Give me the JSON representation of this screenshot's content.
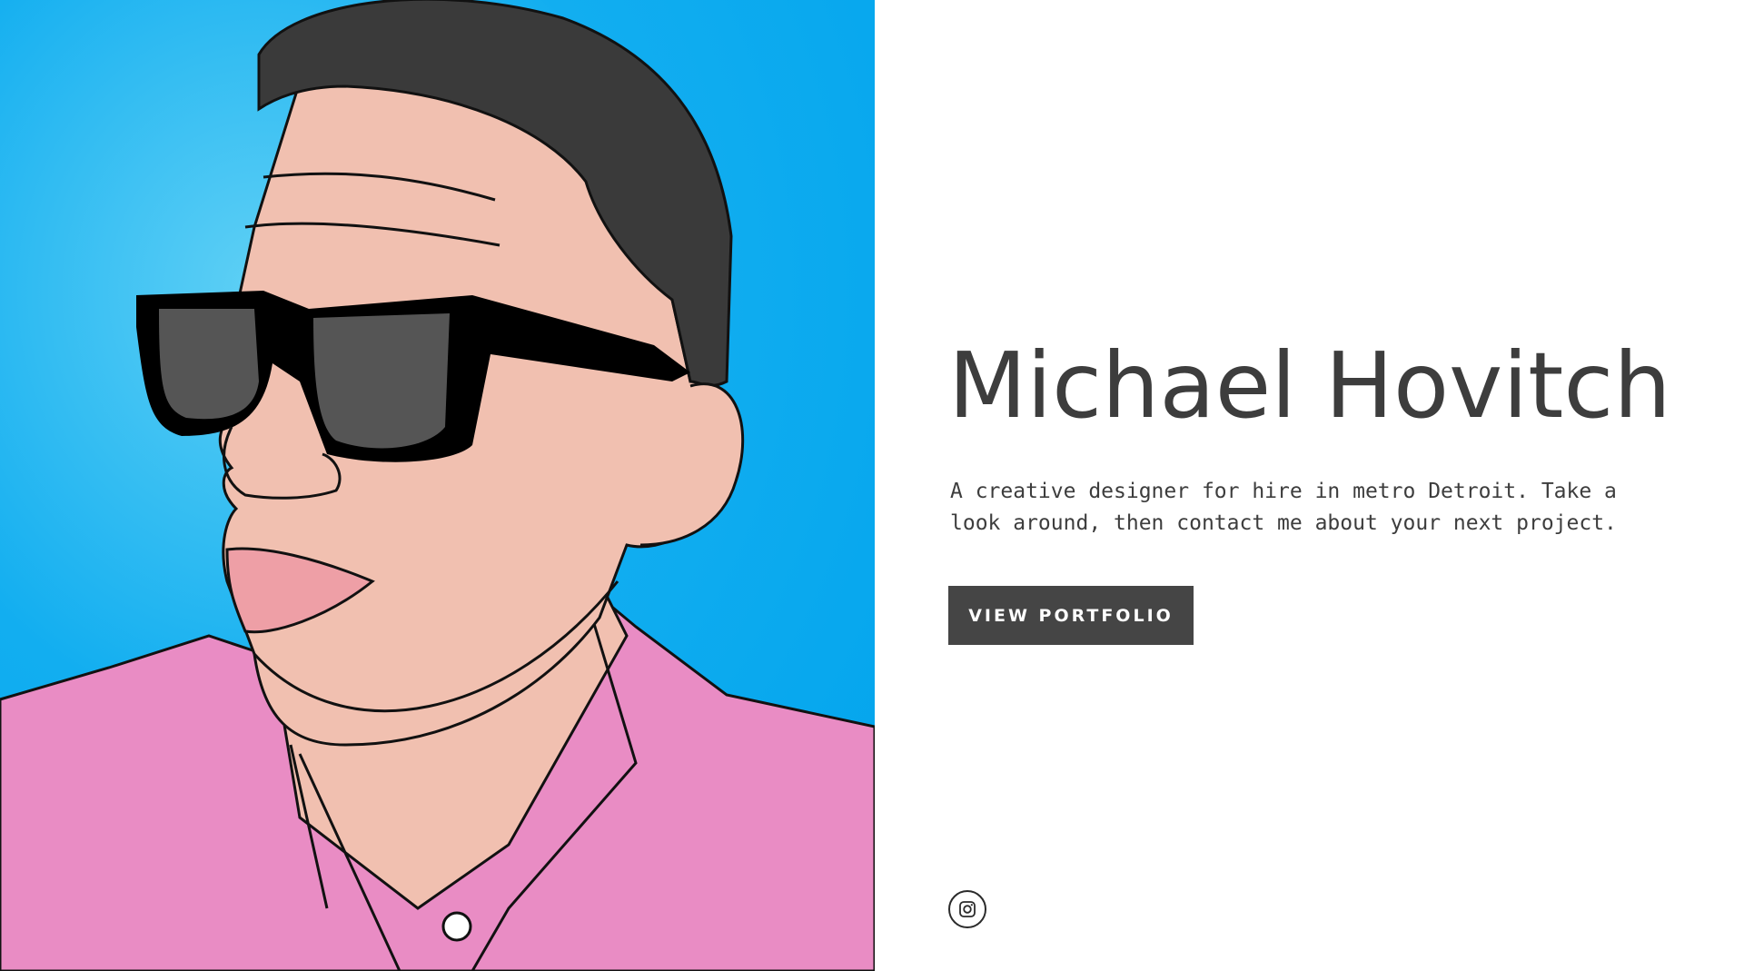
{
  "hero": {
    "name": "Michael Hovitch",
    "tagline": "A creative designer for hire in metro Detroit. Take a look around, then contact me about your next project.",
    "cta_label": "VIEW PORTFOLIO"
  },
  "social": {
    "icon": "instagram-icon"
  },
  "colors": {
    "background": "#ffffff",
    "portrait_background": "#00a3ec",
    "shirt": "#e98cc4",
    "skin": "#f1c0b0",
    "hair": "#3a3a3a",
    "text": "#3d3d3d",
    "button": "#454545"
  }
}
